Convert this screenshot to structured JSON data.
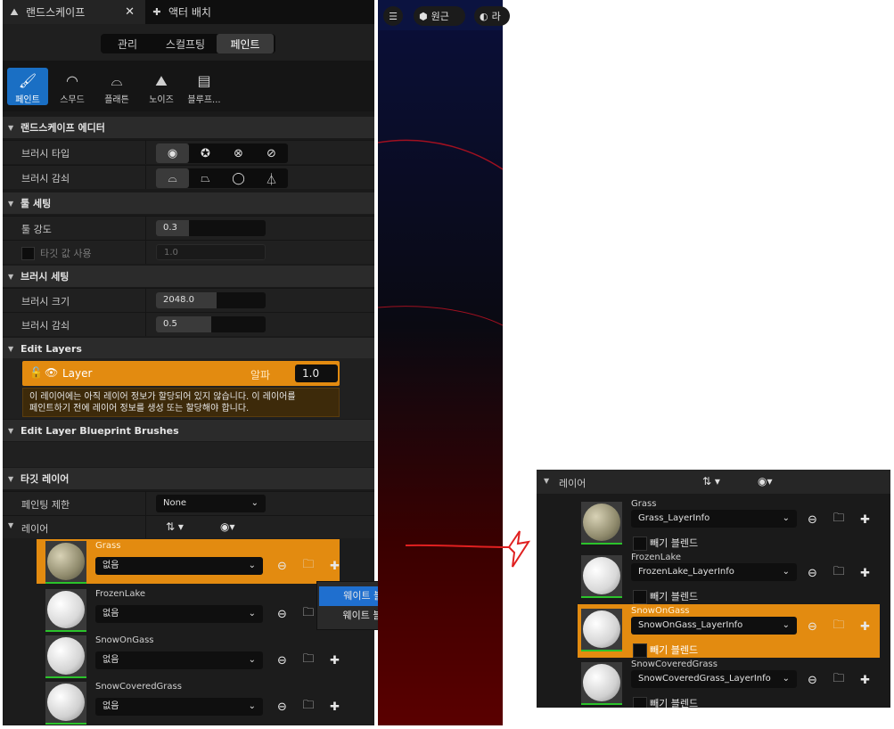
{
  "tabs": [
    {
      "label": "랜드스케이프",
      "icon": "landscape-icon"
    },
    {
      "label": "액터 배치",
      "icon": "place-actor-icon"
    }
  ],
  "modes": [
    {
      "label": "관리",
      "active": false
    },
    {
      "label": "스컬프팅",
      "active": false
    },
    {
      "label": "페인트",
      "active": true
    }
  ],
  "tools": [
    {
      "label": "페인트",
      "icon": "paint-brush-icon",
      "active": true
    },
    {
      "label": "스무드",
      "icon": "smooth-icon",
      "active": false
    },
    {
      "label": "플래튼",
      "icon": "flatten-icon",
      "active": false
    },
    {
      "label": "노이즈",
      "icon": "noise-icon",
      "active": false
    },
    {
      "label": "블루프...",
      "icon": "blueprint-icon",
      "active": false
    }
  ],
  "landscape_editor": {
    "title": "랜드스케이프 에디터",
    "brush_type_label": "브러시 타입",
    "brush_falloff_label": "브러시 감쇠"
  },
  "tool_settings": {
    "title": "툴 세팅",
    "strength_label": "툴 강도",
    "strength_value": "0.3",
    "strength_fraction": 0.3,
    "target_label": "타깃 값 사용",
    "target_value": "1.0"
  },
  "brush_settings": {
    "title": "브러시 세팅",
    "size_label": "브러시 크기",
    "size_value": "2048.0",
    "size_fraction": 0.55,
    "falloff_label": "브러시 감쇠",
    "falloff_value": "0.5",
    "falloff_fraction": 0.5
  },
  "edit_layers": {
    "title": "Edit Layers",
    "layer_name": "Layer",
    "alpha_label": "알파",
    "alpha_value": "1.0",
    "warning_line1": "이 레이어에는 아직 레이어 정보가 할당되어 있지 않습니다. 이 레이어를",
    "warning_line2": "페인트하기 전에 레이어 정보를 생성 또는 할당해야 합니다."
  },
  "blueprint_brushes": {
    "title": "Edit Layer Blueprint Brushes"
  },
  "target_layers": {
    "title": "타깃 레이어",
    "paint_limit_label": "페인팅 제한",
    "paint_limit_value": "None",
    "layers_label": "레이어",
    "sort_icon": "⇅ ▾",
    "visibility_icon": "◉▾",
    "layers": [
      {
        "name": "Grass",
        "info": "없음",
        "selected": true,
        "kind": "grass"
      },
      {
        "name": "FrozenLake",
        "info": "없음",
        "selected": false,
        "kind": "snow"
      },
      {
        "name": "SnowOnGass",
        "info": "없음",
        "selected": false,
        "kind": "snow"
      },
      {
        "name": "SnowCoveredGrass",
        "info": "없음",
        "selected": false,
        "kind": "snow"
      }
    ]
  },
  "context_menu": {
    "items": [
      {
        "label": "웨이트 블렌딩된 레이어 (노멀)",
        "highlighted": true
      },
      {
        "label": "웨이트 블렌딩되지 않은 레이어",
        "highlighted": false
      }
    ]
  },
  "viewport": {
    "menu_icon": "hamburger-icon",
    "perspective_label": "원근",
    "lit_label": "라"
  },
  "right_panel": {
    "layers_label": "레이어",
    "sort_icon": "⇅ ▾",
    "visibility_icon": "◉▾",
    "checkbox_label": "빼기 블렌드",
    "layers": [
      {
        "name": "Grass",
        "info": "Grass_LayerInfo",
        "selected": false,
        "kind": "grass"
      },
      {
        "name": "FrozenLake",
        "info": "FrozenLake_LayerInfo",
        "selected": false,
        "kind": "snow"
      },
      {
        "name": "SnowOnGass",
        "info": "SnowOnGass_LayerInfo",
        "selected": true,
        "kind": "snow"
      },
      {
        "name": "SnowCoveredGrass",
        "info": "SnowCoveredGrass_LayerInfo",
        "selected": false,
        "kind": "snow"
      }
    ]
  },
  "colors": {
    "accent_orange": "#e38b10",
    "selection_blue": "#1f6fcf",
    "tool_active_blue": "#1a6fc4",
    "annotation_red": "#e02020"
  }
}
